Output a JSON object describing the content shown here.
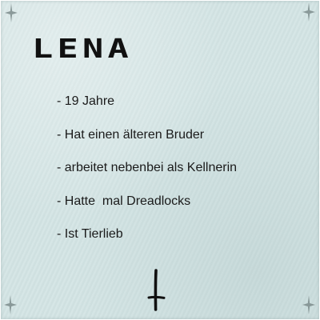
{
  "title": "LENA",
  "facts": [
    "- 19 Jahre",
    "- Hat einen älteren Bruder",
    "- arbeitet nebenbei als Kellnerin",
    "- Hatte  mal Dreadlocks",
    "- Ist Tierlieb"
  ],
  "icons": {
    "corners": "sparkle-icon",
    "bottom": "inverted-cross-icon"
  },
  "colors": {
    "background": "#d3e4e4",
    "text": "#1a1a1a",
    "ornament": "#7d8c8c",
    "cross": "#111111"
  }
}
